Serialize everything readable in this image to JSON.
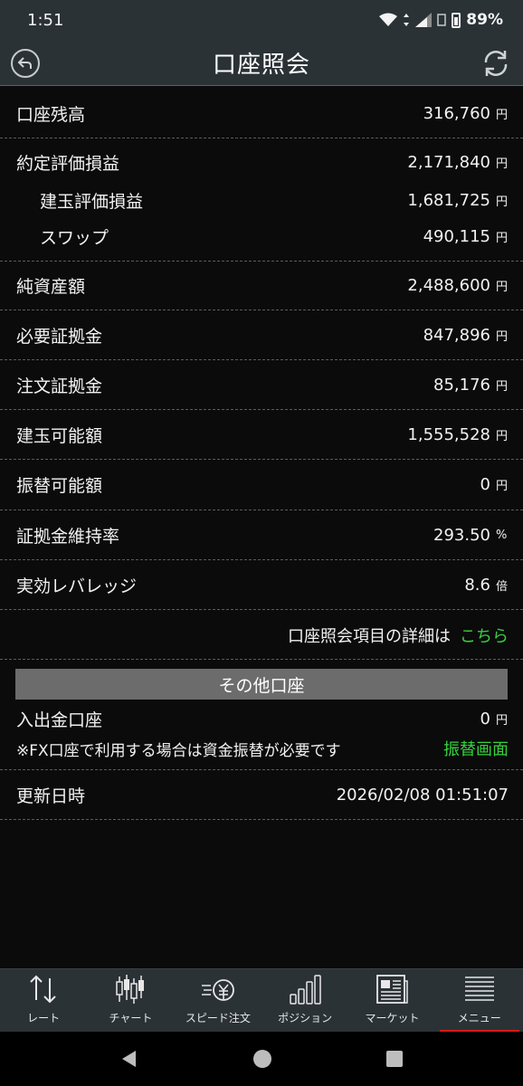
{
  "status_bar": {
    "time": "1:51",
    "battery": "89%"
  },
  "header": {
    "title": "口座照会"
  },
  "rows": [
    {
      "label": "口座残高",
      "value": "316,760",
      "unit": "円"
    },
    {
      "label": "約定評価損益",
      "value": "2,171,840",
      "unit": "円"
    },
    {
      "label": "建玉評価損益",
      "value": "1,681,725",
      "unit": "円"
    },
    {
      "label": "スワップ",
      "value": "490,115",
      "unit": "円"
    },
    {
      "label": "純資産額",
      "value": "2,488,600",
      "unit": "円"
    },
    {
      "label": "必要証拠金",
      "value": "847,896",
      "unit": "円"
    },
    {
      "label": "注文証拠金",
      "value": "85,176",
      "unit": "円"
    },
    {
      "label": "建玉可能額",
      "value": "1,555,528",
      "unit": "円"
    },
    {
      "label": "振替可能額",
      "value": "0",
      "unit": "円"
    },
    {
      "label": "証拠金維持率",
      "value": "293.50",
      "unit": "%"
    },
    {
      "label": "実効レバレッジ",
      "value": "8.6",
      "unit": "倍"
    }
  ],
  "detail": {
    "text": "口座照会項目の詳細は",
    "link": "こちら"
  },
  "other_accounts": {
    "title": "その他口座",
    "deposit_label": "入出金口座",
    "deposit_value": "0",
    "deposit_unit": "円",
    "note": "※FX口座で利用する場合は資金振替が必要です",
    "transfer_link": "振替画面"
  },
  "updated": {
    "label": "更新日時",
    "value": "2026/02/08 01:51:07"
  },
  "tabs": [
    {
      "label": "レート",
      "icon": "arrows-updown-icon"
    },
    {
      "label": "チャート",
      "icon": "candlestick-icon"
    },
    {
      "label": "スピード注文",
      "icon": "speed-order-icon"
    },
    {
      "label": "ポジション",
      "icon": "bar-chart-icon"
    },
    {
      "label": "マーケット",
      "icon": "news-icon"
    },
    {
      "label": "メニュー",
      "icon": "menu-icon",
      "active": true
    }
  ],
  "colors": {
    "accent_green": "#35d13d",
    "active_tab": "#d61a1a",
    "header_bg": "#2b3236",
    "section_bg": "#6c6c6c"
  }
}
